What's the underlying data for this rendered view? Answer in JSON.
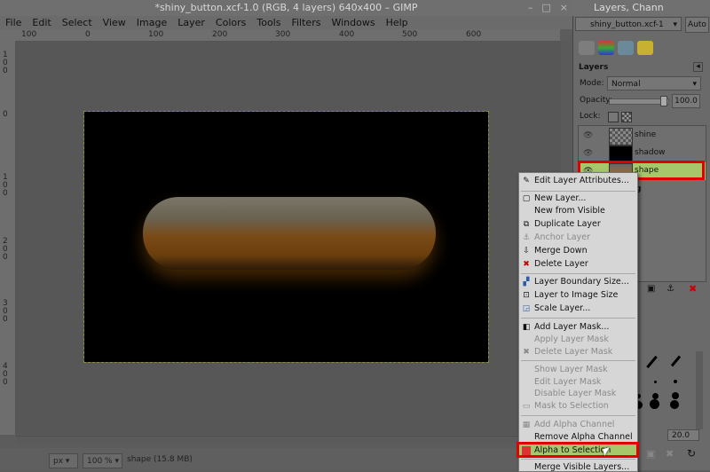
{
  "window": {
    "title": "*shiny_button.xcf-1.0 (RGB, 4 layers) 640x400 – GIMP",
    "controls": [
      "–",
      "□",
      "×"
    ]
  },
  "menubar": [
    "File",
    "Edit",
    "Select",
    "View",
    "Image",
    "Layer",
    "Colors",
    "Tools",
    "Filters",
    "Windows",
    "Help"
  ],
  "rulers": {
    "h_labels": [
      "100",
      "0",
      "100",
      "200",
      "300",
      "400",
      "500",
      "600"
    ],
    "v_labels": [
      "100",
      "0",
      "100",
      "200",
      "300",
      "400"
    ]
  },
  "status": {
    "unit": "px",
    "zoom": "100 %",
    "info": "shape (15.8 MB)"
  },
  "dock": {
    "title": "Layers, Chann",
    "image_select": "shiny_button.xcf-1",
    "auto_label": "Auto",
    "layers_label": "Layers",
    "mode_label": "Mode:",
    "mode_value": "Normal",
    "opacity_label": "Opacity:",
    "opacity_value": "100.0",
    "lock_label": "Lock:",
    "layers": [
      {
        "name": "shine"
      },
      {
        "name": "shadow"
      },
      {
        "name": "shape"
      }
    ],
    "partial_layer": "g",
    "brush_partial": "s)",
    "brush_size": "20.0"
  },
  "context_menu": {
    "items": [
      {
        "label": "Edit Layer Attributes...",
        "enabled": true,
        "icon": "pencil-icon"
      },
      {
        "label": "New Layer...",
        "enabled": true,
        "icon": "new-layer-icon"
      },
      {
        "label": "New from Visible",
        "enabled": true,
        "icon": ""
      },
      {
        "label": "Duplicate Layer",
        "enabled": true,
        "icon": "duplicate-icon"
      },
      {
        "label": "Anchor Layer",
        "enabled": false,
        "icon": "anchor-icon"
      },
      {
        "label": "Merge Down",
        "enabled": true,
        "icon": "merge-down-icon"
      },
      {
        "label": "Delete Layer",
        "enabled": true,
        "icon": "delete-icon"
      },
      {
        "label": "Layer Boundary Size...",
        "enabled": true,
        "icon": "boundary-icon"
      },
      {
        "label": "Layer to Image Size",
        "enabled": true,
        "icon": "to-image-size-icon"
      },
      {
        "label": "Scale Layer...",
        "enabled": true,
        "icon": "scale-icon"
      },
      {
        "label": "Add Layer Mask...",
        "enabled": true,
        "icon": "add-mask-icon"
      },
      {
        "label": "Apply Layer Mask",
        "enabled": false,
        "icon": ""
      },
      {
        "label": "Delete Layer Mask",
        "enabled": false,
        "icon": "delete-mask-icon"
      },
      {
        "label": "Show Layer Mask",
        "enabled": false,
        "icon": ""
      },
      {
        "label": "Edit Layer Mask",
        "enabled": false,
        "icon": ""
      },
      {
        "label": "Disable Layer Mask",
        "enabled": false,
        "icon": ""
      },
      {
        "label": "Mask to Selection",
        "enabled": false,
        "icon": "mask-selection-icon"
      },
      {
        "label": "Add Alpha Channel",
        "enabled": false,
        "icon": "alpha-icon"
      },
      {
        "label": "Remove Alpha Channel",
        "enabled": true,
        "icon": ""
      },
      {
        "label": "Alpha to Selection",
        "enabled": true,
        "icon": "alpha-selection-icon"
      },
      {
        "label": "Merge Visible Layers...",
        "enabled": true,
        "icon": ""
      }
    ]
  },
  "colors": {
    "selection_green": "#a6c86a",
    "highlight_red": "#e00000"
  }
}
